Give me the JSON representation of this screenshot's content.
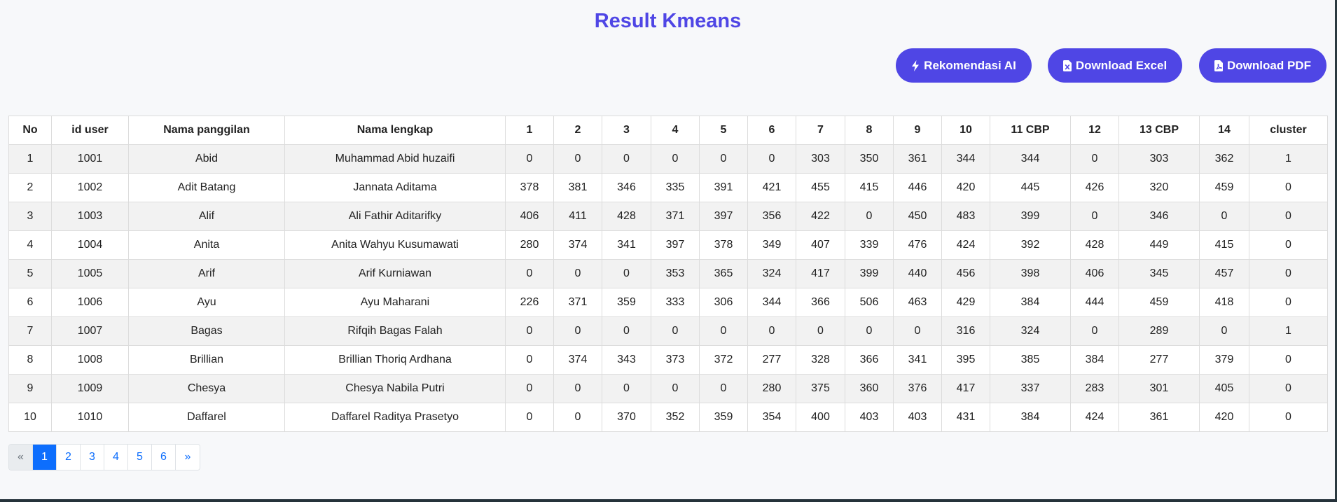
{
  "page": {
    "title": "Result Kmeans"
  },
  "actions": {
    "ai_label": "Rekomendasi AI",
    "excel_label": "Download Excel",
    "pdf_label": "Download PDF",
    "accent_color": "#4f46e5"
  },
  "table": {
    "headers": [
      "No",
      "id user",
      "Nama panggilan",
      "Nama lengkap",
      "1",
      "2",
      "3",
      "4",
      "5",
      "6",
      "7",
      "8",
      "9",
      "10",
      "11 CBP",
      "12",
      "13 CBP",
      "14",
      "cluster"
    ],
    "rows": [
      [
        "1",
        "1001",
        "Abid",
        "Muhammad Abid huzaifi",
        "0",
        "0",
        "0",
        "0",
        "0",
        "0",
        "303",
        "350",
        "361",
        "344",
        "344",
        "0",
        "303",
        "362",
        "1"
      ],
      [
        "2",
        "1002",
        "Adit Batang",
        "Jannata Aditama",
        "378",
        "381",
        "346",
        "335",
        "391",
        "421",
        "455",
        "415",
        "446",
        "420",
        "445",
        "426",
        "320",
        "459",
        "0"
      ],
      [
        "3",
        "1003",
        "Alif",
        "Ali Fathir Aditarifky",
        "406",
        "411",
        "428",
        "371",
        "397",
        "356",
        "422",
        "0",
        "450",
        "483",
        "399",
        "0",
        "346",
        "0",
        "0"
      ],
      [
        "4",
        "1004",
        "Anita",
        "Anita Wahyu Kusumawati",
        "280",
        "374",
        "341",
        "397",
        "378",
        "349",
        "407",
        "339",
        "476",
        "424",
        "392",
        "428",
        "449",
        "415",
        "0"
      ],
      [
        "5",
        "1005",
        "Arif",
        "Arif Kurniawan",
        "0",
        "0",
        "0",
        "353",
        "365",
        "324",
        "417",
        "399",
        "440",
        "456",
        "398",
        "406",
        "345",
        "457",
        "0"
      ],
      [
        "6",
        "1006",
        "Ayu",
        "Ayu Maharani",
        "226",
        "371",
        "359",
        "333",
        "306",
        "344",
        "366",
        "506",
        "463",
        "429",
        "384",
        "444",
        "459",
        "418",
        "0"
      ],
      [
        "7",
        "1007",
        "Bagas",
        "Rifqih Bagas Falah",
        "0",
        "0",
        "0",
        "0",
        "0",
        "0",
        "0",
        "0",
        "0",
        "316",
        "324",
        "0",
        "289",
        "0",
        "1"
      ],
      [
        "8",
        "1008",
        "Brillian",
        "Brillian Thoriq Ardhana",
        "0",
        "374",
        "343",
        "373",
        "372",
        "277",
        "328",
        "366",
        "341",
        "395",
        "385",
        "384",
        "277",
        "379",
        "0"
      ],
      [
        "9",
        "1009",
        "Chesya",
        "Chesya Nabila Putri",
        "0",
        "0",
        "0",
        "0",
        "0",
        "280",
        "375",
        "360",
        "376",
        "417",
        "337",
        "283",
        "301",
        "405",
        "0"
      ],
      [
        "10",
        "1010",
        "Daffarel",
        "Daffarel Raditya Prasetyo",
        "0",
        "0",
        "370",
        "352",
        "359",
        "354",
        "400",
        "403",
        "403",
        "431",
        "384",
        "424",
        "361",
        "420",
        "0"
      ]
    ]
  },
  "pagination": {
    "prev": "«",
    "pages": [
      "1",
      "2",
      "3",
      "4",
      "5",
      "6"
    ],
    "current": "1",
    "next": "»"
  }
}
